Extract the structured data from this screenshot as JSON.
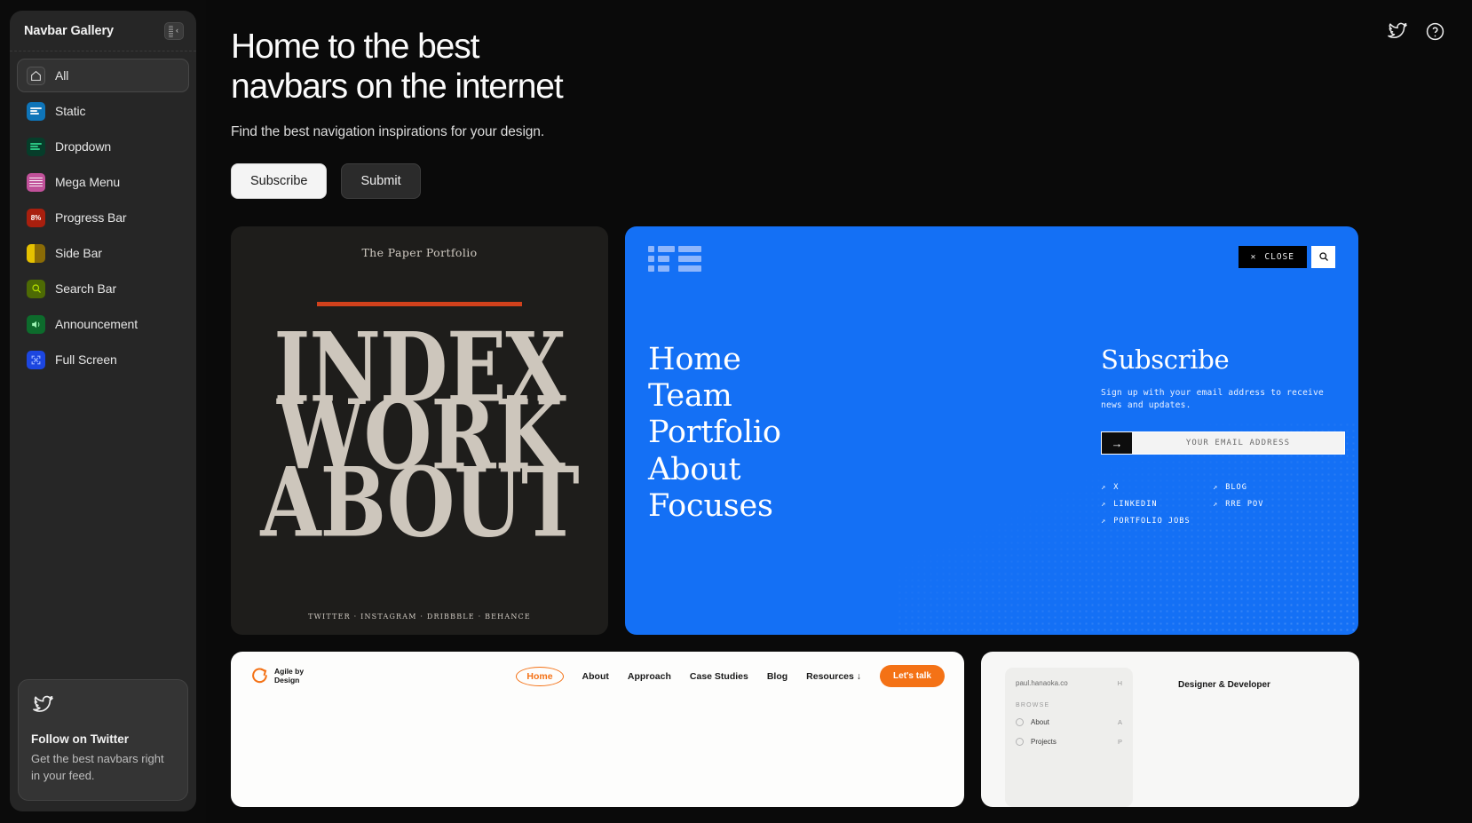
{
  "sidebar": {
    "title": "Navbar Gallery",
    "collapse_icon": "sidebar-collapse-icon",
    "items": [
      {
        "label": "All",
        "icon": "home-icon",
        "active": true
      },
      {
        "label": "Static",
        "icon": "static-navbar-icon",
        "active": false
      },
      {
        "label": "Dropdown",
        "icon": "dropdown-navbar-icon",
        "active": false
      },
      {
        "label": "Mega Menu",
        "icon": "mega-menu-icon",
        "active": false
      },
      {
        "label": "Progress Bar",
        "icon": "progress-bar-icon",
        "active": false
      },
      {
        "label": "Side Bar",
        "icon": "side-bar-icon",
        "active": false
      },
      {
        "label": "Search Bar",
        "icon": "search-bar-icon",
        "active": false
      },
      {
        "label": "Announcement",
        "icon": "announcement-icon",
        "active": false
      },
      {
        "label": "Full Screen",
        "icon": "full-screen-icon",
        "active": false
      }
    ],
    "progress_badge": "8%",
    "promo": {
      "icon": "twitter-bird-icon",
      "title": "Follow on Twitter",
      "subtitle": "Get the best navbars right in your feed."
    }
  },
  "topbar": {
    "twitter_icon": "twitter-icon",
    "help_icon": "help-circle-icon"
  },
  "hero": {
    "heading": "Home to the best\nnavbars on the internet",
    "subheading": "Find the best navigation inspirations for your design.",
    "primary_button": "Subscribe",
    "secondary_button": "Submit"
  },
  "colors": {
    "page_bg": "#0a0a0a",
    "sidebar_bg": "#262626",
    "accent_blue": "#1470f5",
    "accent_orange": "#f47216",
    "paper_red": "#d1411c"
  },
  "gallery": {
    "paper_card": {
      "brand": "The Paper Portfolio",
      "words": [
        "INDEX",
        "WORK",
        "ABOUT"
      ],
      "struck_word": "INDEX",
      "social": "TWITTER · INSTAGRAM · DRIBBBLE · BEHANCE"
    },
    "blue_card": {
      "logo": "rre-logo-icon",
      "close_label": "CLOSE",
      "close_icon": "close-icon",
      "search_icon": "search-icon",
      "nav_links": [
        "Home",
        "Team",
        "Portfolio",
        "About",
        "Focuses"
      ],
      "subscribe_title": "Subscribe",
      "subscribe_text": "Sign up with your email address to receive news and updates.",
      "email_placeholder": "YOUR EMAIL ADDRESS",
      "submit_arrow": "arrow-right-icon",
      "links": [
        "X",
        "BLOG",
        "LINKEDIN",
        "RRE POV",
        "PORTFOLIO JOBS"
      ]
    },
    "agile_card": {
      "logo_icon": "agile-logo-icon",
      "brand_line1": "Agile by",
      "brand_line2": "Design",
      "menu": [
        "Home",
        "About",
        "Approach",
        "Case Studies",
        "Blog",
        "Resources ↓"
      ],
      "active_menu": "Home",
      "cta": "Let's talk"
    },
    "paul_card": {
      "brand_bold": "paul.",
      "brand_rest": "hanaoka.co",
      "brand_key": "H",
      "section": "BROWSE",
      "items": [
        {
          "label": "About",
          "key": "A",
          "icon": "circle-icon"
        },
        {
          "label": "Projects",
          "key": "P",
          "icon": "layers-icon"
        }
      ],
      "title": "Designer & Developer"
    }
  }
}
